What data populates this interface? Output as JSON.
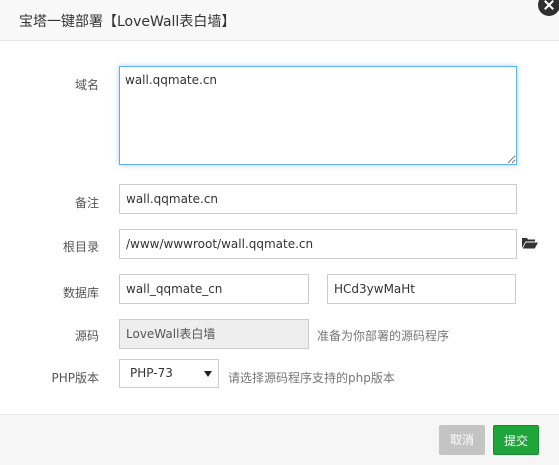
{
  "dialog": {
    "title": "宝塔一键部署【LoveWall表白墙】"
  },
  "form": {
    "domain_label": "域名",
    "domain_value": "wall.qqmate.cn",
    "note_label": "备注",
    "note_value": "wall.qqmate.cn",
    "root_label": "根目录",
    "root_value": "/www/wwwroot/wall.qqmate.cn",
    "db_label": "数据库",
    "db_name": "wall_qqmate_cn",
    "db_password": "HCd3ywMaHt",
    "source_label": "源码",
    "source_value": "LoveWall表白墙",
    "source_hint": "准备为你部署的源码程序",
    "php_label": "PHP版本",
    "php_selected": "PHP-73",
    "php_hint": "请选择源码程序支持的php版本"
  },
  "footer": {
    "cancel_label": "取消",
    "submit_label": "提交"
  },
  "colors": {
    "submit": "#20a53a",
    "cancel": "#c4c4c4",
    "focus": "#66afe9"
  },
  "icons": {
    "close": "close-icon",
    "folder": "folder-open-icon",
    "dropdown": "chevron-down-icon"
  }
}
